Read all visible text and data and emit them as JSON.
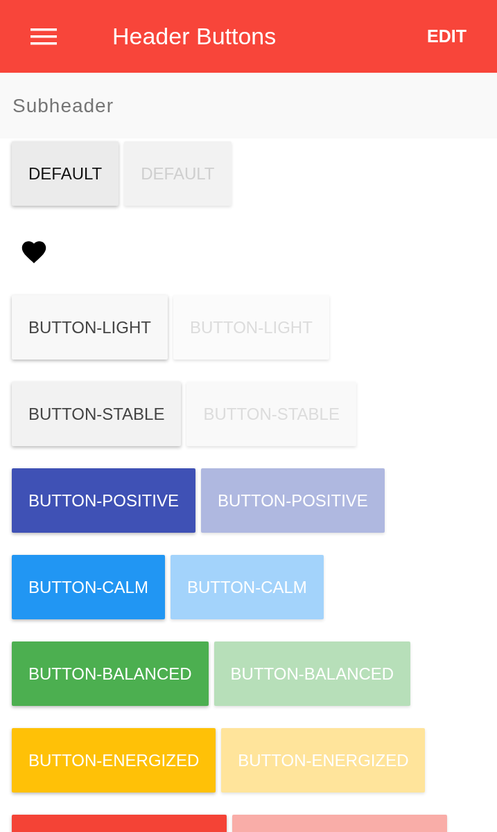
{
  "header": {
    "title": "Header Buttons",
    "action": "EDIT"
  },
  "subheader": "Subheader",
  "groups": [
    {
      "kind": "buttons",
      "buttons": [
        {
          "label": "DEFAULT",
          "kind": "default",
          "disabled": false
        },
        {
          "label": "DEFAULT",
          "kind": "default",
          "disabled": true
        }
      ]
    },
    {
      "kind": "heart"
    },
    {
      "kind": "buttons",
      "buttons": [
        {
          "label": "BUTTON-LIGHT",
          "kind": "light",
          "disabled": false
        },
        {
          "label": "BUTTON-LIGHT",
          "kind": "light",
          "disabled": true
        }
      ]
    },
    {
      "kind": "buttons",
      "buttons": [
        {
          "label": "BUTTON-STABLE",
          "kind": "stable",
          "disabled": false
        },
        {
          "label": "BUTTON-STABLE",
          "kind": "stable",
          "disabled": true
        }
      ]
    },
    {
      "kind": "buttons",
      "buttons": [
        {
          "label": "BUTTON-POSITIVE",
          "kind": "positive",
          "disabled": false
        },
        {
          "label": "BUTTON-POSITIVE",
          "kind": "positive",
          "disabled": true
        }
      ]
    },
    {
      "kind": "buttons",
      "buttons": [
        {
          "label": "BUTTON-CALM",
          "kind": "calm",
          "disabled": false
        },
        {
          "label": "BUTTON-CALM",
          "kind": "calm",
          "disabled": true
        }
      ]
    },
    {
      "kind": "buttons",
      "buttons": [
        {
          "label": "BUTTON-BALANCED",
          "kind": "balanced",
          "disabled": false
        },
        {
          "label": "BUTTON-BALANCED",
          "kind": "balanced",
          "disabled": true
        }
      ]
    },
    {
      "kind": "buttons",
      "buttons": [
        {
          "label": "BUTTON-ENERGIZED",
          "kind": "energized",
          "disabled": false
        },
        {
          "label": "BUTTON-ENERGIZED",
          "kind": "energized",
          "disabled": true
        }
      ]
    },
    {
      "kind": "buttons",
      "buttons": [
        {
          "kind": "assertive",
          "disabled": false
        },
        {
          "kind": "assertive",
          "disabled": true
        }
      ]
    }
  ]
}
